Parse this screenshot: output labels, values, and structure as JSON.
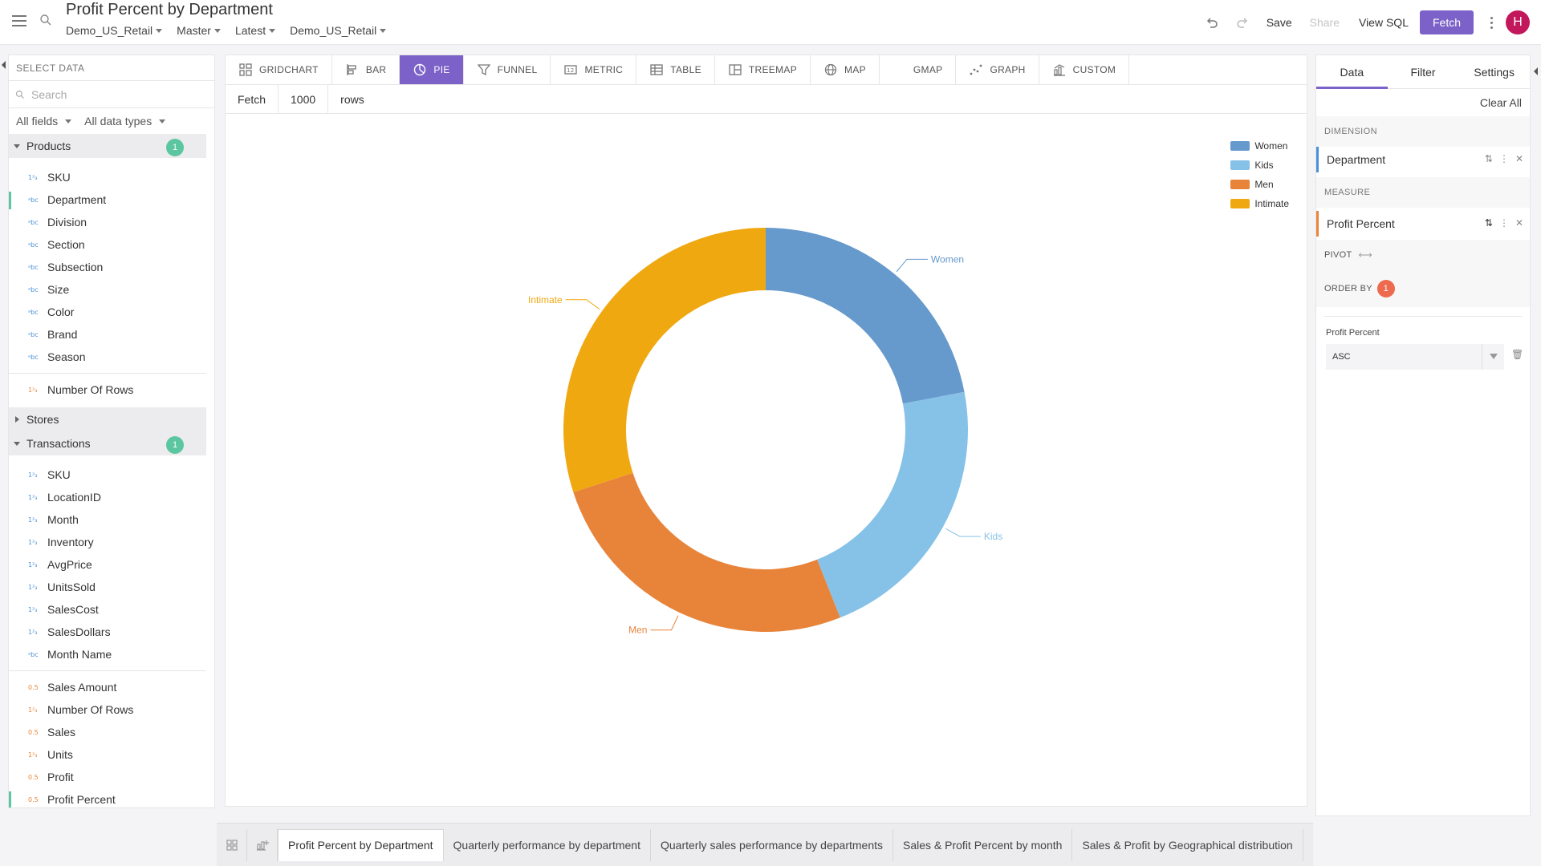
{
  "header": {
    "title": "Profit Percent by Department",
    "breadcrumbs": [
      "Demo_US_Retail",
      "Master",
      "Latest",
      "Demo_US_Retail"
    ],
    "actions": {
      "save": "Save",
      "share": "Share",
      "view_sql": "View SQL",
      "fetch": "Fetch"
    },
    "avatar_initial": "H"
  },
  "left_panel": {
    "title": "SELECT DATA",
    "search_placeholder": "Search",
    "filters": [
      "All fields",
      "All data types"
    ],
    "groups": [
      {
        "name": "Products",
        "badge": "1",
        "expanded": true,
        "fields": [
          {
            "label": "SKU",
            "type": "num"
          },
          {
            "label": "Department",
            "type": "str",
            "selected": true
          },
          {
            "label": "Division",
            "type": "str"
          },
          {
            "label": "Section",
            "type": "str"
          },
          {
            "label": "Subsection",
            "type": "str"
          },
          {
            "label": "Size",
            "type": "str"
          },
          {
            "label": "Color",
            "type": "str"
          },
          {
            "label": "Brand",
            "type": "str"
          },
          {
            "label": "Season",
            "type": "str"
          }
        ],
        "measures": [
          {
            "label": "Number Of Rows",
            "type": "m"
          }
        ]
      },
      {
        "name": "Stores",
        "expanded": false
      },
      {
        "name": "Transactions",
        "badge": "1",
        "expanded": true,
        "fields": [
          {
            "label": "SKU",
            "type": "num"
          },
          {
            "label": "LocationID",
            "type": "num"
          },
          {
            "label": "Month",
            "type": "num"
          },
          {
            "label": "Inventory",
            "type": "num"
          },
          {
            "label": "AvgPrice",
            "type": "num"
          },
          {
            "label": "UnitsSold",
            "type": "num"
          },
          {
            "label": "SalesCost",
            "type": "num"
          },
          {
            "label": "SalesDollars",
            "type": "num"
          },
          {
            "label": "Month Name",
            "type": "str"
          }
        ],
        "measures": [
          {
            "label": "Sales Amount",
            "type": "m"
          },
          {
            "label": "Number Of Rows",
            "type": "m"
          },
          {
            "label": "Sales",
            "type": "m"
          },
          {
            "label": "Units",
            "type": "m"
          },
          {
            "label": "Profit",
            "type": "m"
          },
          {
            "label": "Profit Percent",
            "type": "m",
            "selected": true
          }
        ]
      }
    ]
  },
  "chart_toolbar": {
    "items": [
      {
        "label": "GRIDCHART",
        "icon": "grid-icon"
      },
      {
        "label": "BAR",
        "icon": "bar-icon"
      },
      {
        "label": "PIE",
        "icon": "pie-icon",
        "active": true
      },
      {
        "label": "FUNNEL",
        "icon": "funnel-icon"
      },
      {
        "label": "METRIC",
        "icon": "metric-icon"
      },
      {
        "label": "TABLE",
        "icon": "table-icon"
      },
      {
        "label": "TREEMAP",
        "icon": "treemap-icon"
      },
      {
        "label": "MAP",
        "icon": "globe-icon"
      },
      {
        "label": "GMAP",
        "icon": ""
      },
      {
        "label": "GRAPH",
        "icon": "graph-icon"
      },
      {
        "label": "CUSTOM",
        "icon": "custom-icon"
      }
    ]
  },
  "fetch_bar": {
    "label": "Fetch",
    "value": "1000",
    "unit": "rows"
  },
  "chart_data": {
    "type": "pie",
    "donut": true,
    "categories": [
      "Women",
      "Kids",
      "Men",
      "Intimate"
    ],
    "values": [
      22,
      22,
      26,
      30
    ],
    "colors": [
      "#6699cc",
      "#86c2e7",
      "#e8833a",
      "#f0a811"
    ],
    "legend_position": "top-right"
  },
  "right_panel": {
    "tabs": [
      "Data",
      "Filter",
      "Settings"
    ],
    "active_tab": "Data",
    "clear_all": "Clear All",
    "dimension_label": "DIMENSION",
    "dimension": "Department",
    "measure_label": "MEASURE",
    "measure": "Profit Percent",
    "pivot_label": "PIVOT",
    "order_by_label": "ORDER BY",
    "order_by_count": "1",
    "order_field": "Profit Percent",
    "order_direction": "ASC"
  },
  "bottom_tabs": [
    "Profit Percent by Department",
    "Quarterly performance by department",
    "Quarterly sales performance by departments",
    "Sales & Profit Percent by month",
    "Sales & Profit by Geographical distribution"
  ]
}
